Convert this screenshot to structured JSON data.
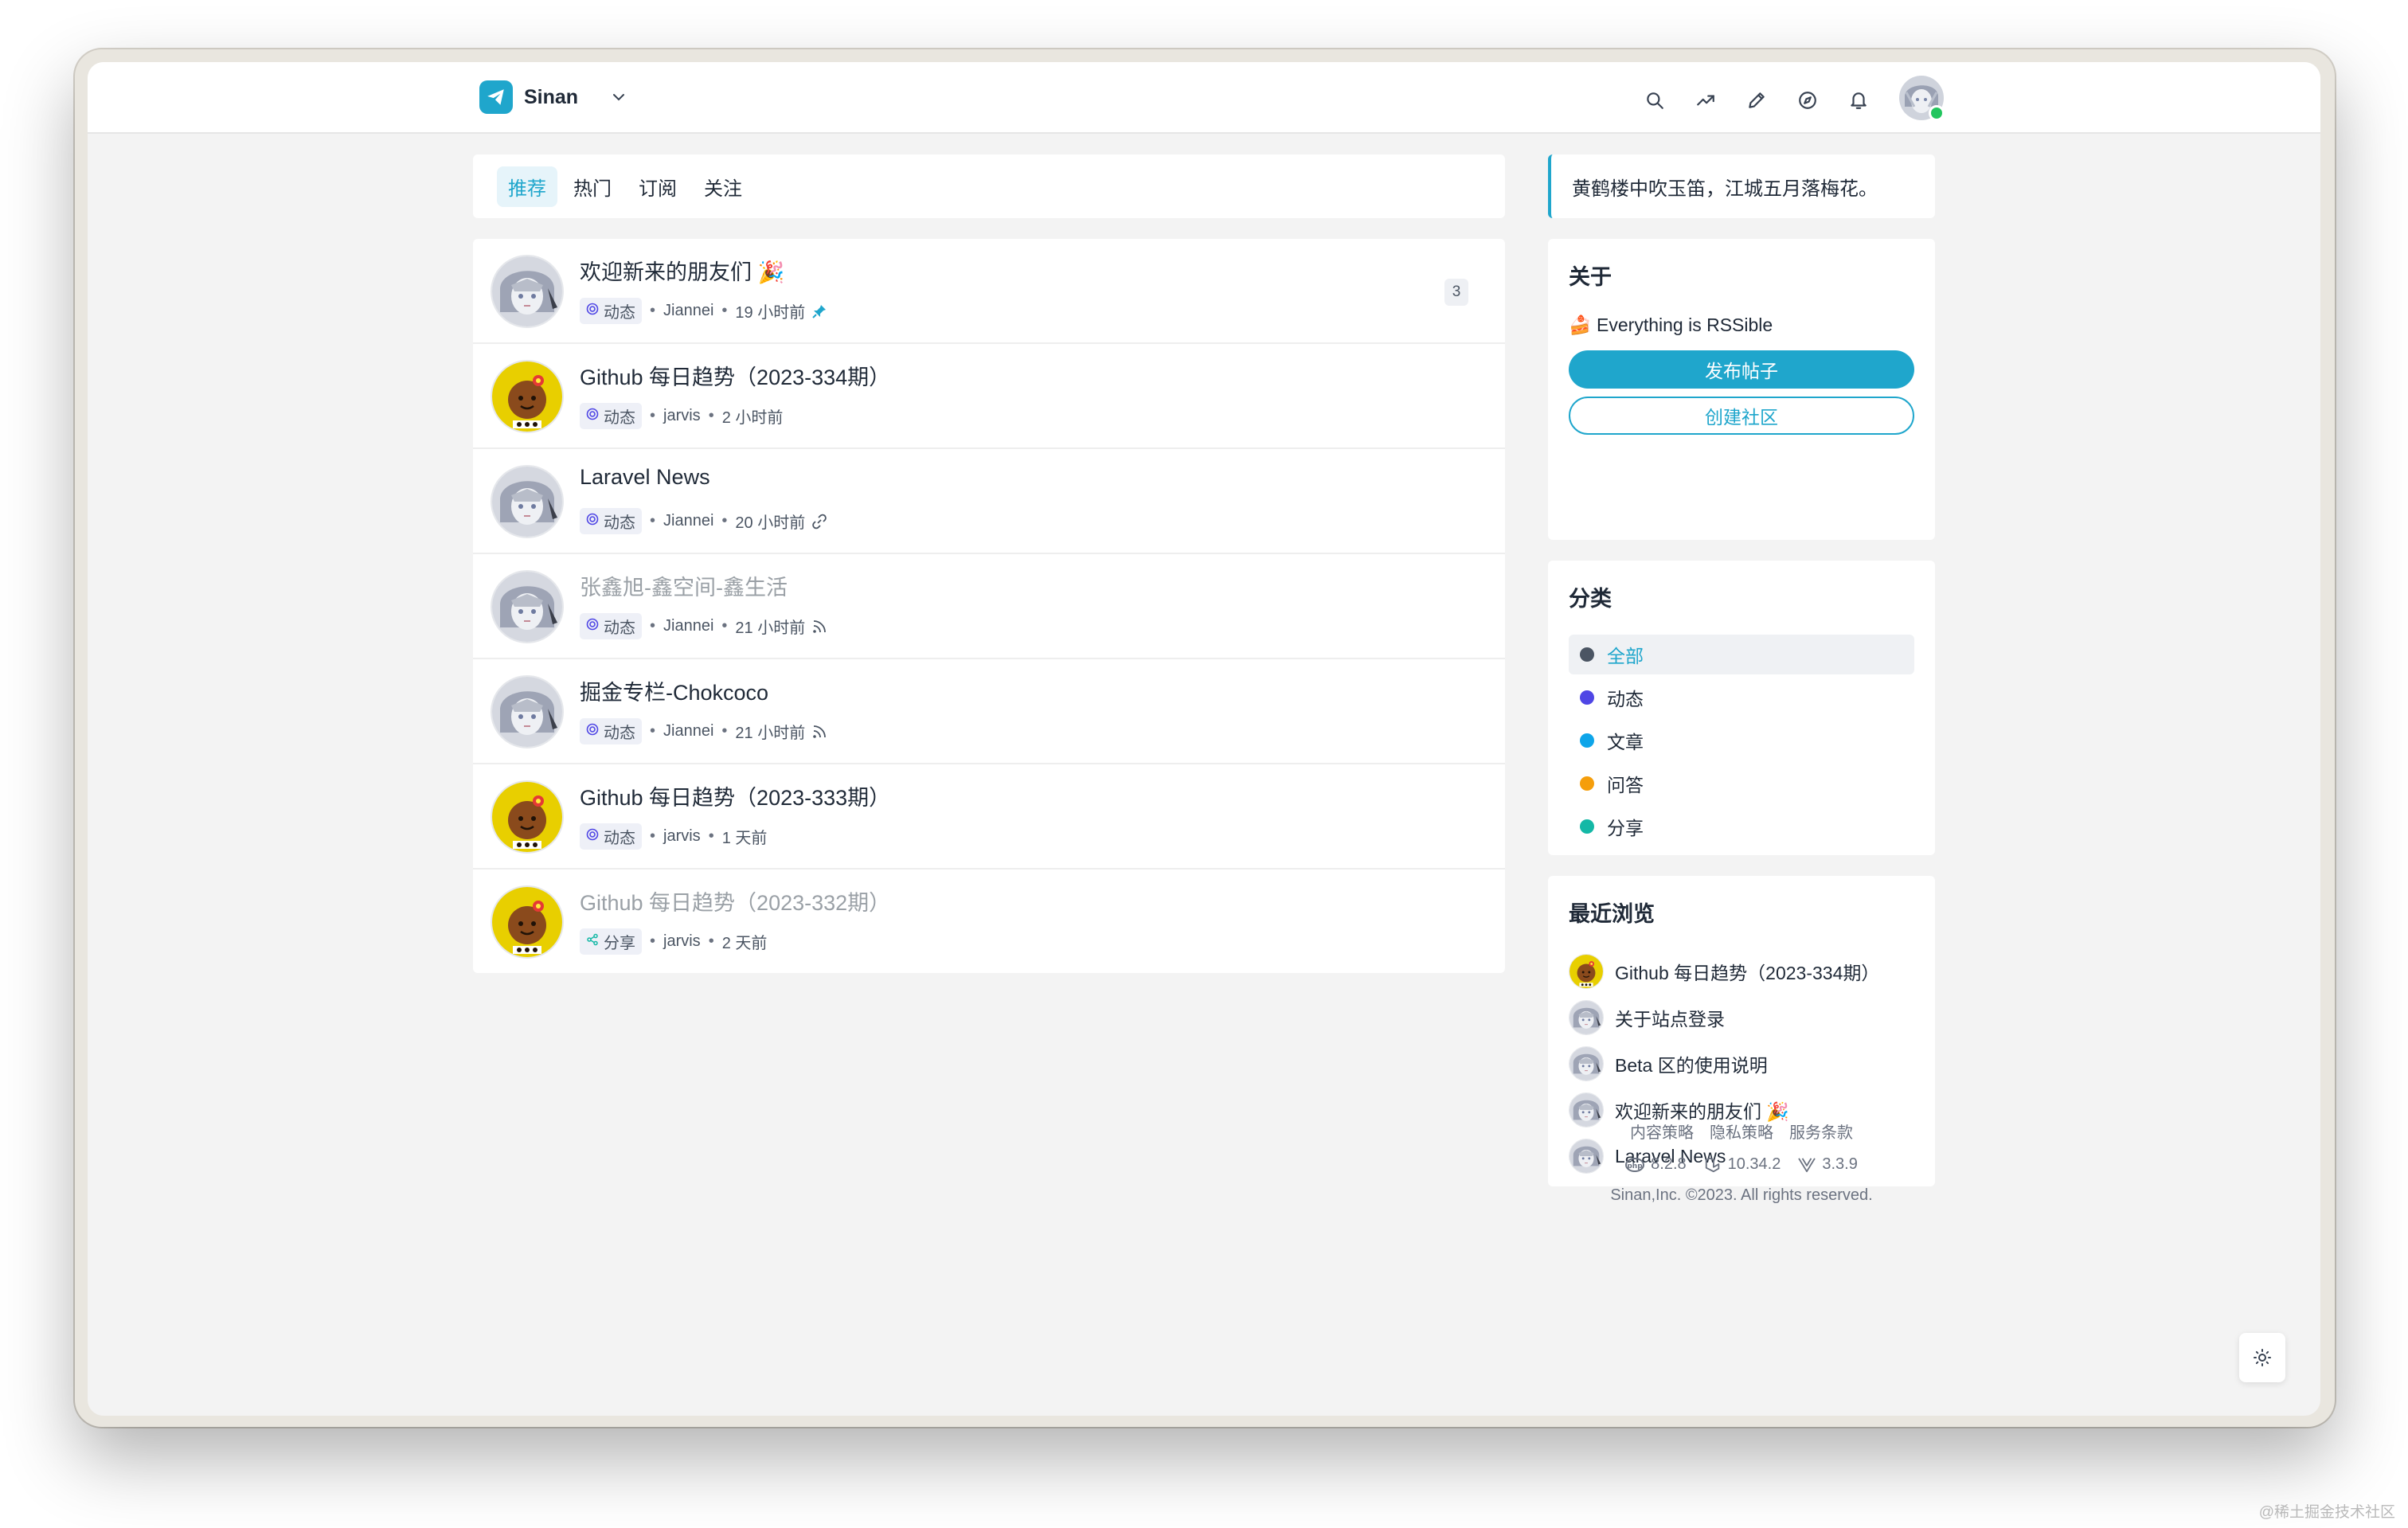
{
  "brand": {
    "name": "Sinan"
  },
  "top_icons": [
    "search-icon",
    "trending-icon",
    "compose-icon",
    "explore-icon",
    "bell-icon"
  ],
  "tabs": [
    {
      "label": "推荐",
      "active": true
    },
    {
      "label": "热门",
      "active": false
    },
    {
      "label": "订阅",
      "active": false
    },
    {
      "label": "关注",
      "active": false
    }
  ],
  "posts": [
    {
      "title": "欢迎新来的朋友们 🎉",
      "tag": "动态",
      "tag_icon": "feed-icon",
      "author": "Jiannei",
      "time": "19 小时前",
      "meta_icon": "pin-icon",
      "avatar": "anime",
      "badge": "3",
      "dim": false
    },
    {
      "title": "Github 每日趋势（2023-334期）",
      "tag": "动态",
      "tag_icon": "feed-icon",
      "author": "jarvis",
      "time": "2 小时前",
      "meta_icon": "",
      "avatar": "bot",
      "badge": "",
      "dim": false
    },
    {
      "title": "Laravel News",
      "tag": "动态",
      "tag_icon": "feed-icon",
      "author": "Jiannei",
      "time": "20 小时前",
      "meta_icon": "link-icon",
      "avatar": "anime",
      "badge": "",
      "dim": false
    },
    {
      "title": "张鑫旭-鑫空间-鑫生活",
      "tag": "动态",
      "tag_icon": "feed-icon",
      "author": "Jiannei",
      "time": "21 小时前",
      "meta_icon": "rss-icon",
      "avatar": "anime",
      "badge": "",
      "dim": true
    },
    {
      "title": "掘金专栏-Chokcoco",
      "tag": "动态",
      "tag_icon": "feed-icon",
      "author": "Jiannei",
      "time": "21 小时前",
      "meta_icon": "rss-icon",
      "avatar": "anime",
      "badge": "",
      "dim": false
    },
    {
      "title": "Github 每日趋势（2023-333期）",
      "tag": "动态",
      "tag_icon": "feed-icon",
      "author": "jarvis",
      "time": "1 天前",
      "meta_icon": "",
      "avatar": "bot",
      "badge": "",
      "dim": false
    },
    {
      "title": "Github 每日趋势（2023-332期）",
      "tag": "分享",
      "tag_icon": "share-icon",
      "author": "jarvis",
      "time": "2 天前",
      "meta_icon": "",
      "avatar": "bot",
      "badge": "",
      "dim": true
    }
  ],
  "quote": "黄鹤楼中吹玉笛，江城五月落梅花。",
  "about": {
    "title": "关于",
    "tagline": "🍰 Everything is RSSible",
    "primary_button": "发布帖子",
    "secondary_button": "创建社区"
  },
  "categories": {
    "title": "分类",
    "items": [
      {
        "label": "全部",
        "color": "#4b5563",
        "active": true
      },
      {
        "label": "动态",
        "color": "#4f46e5",
        "active": false
      },
      {
        "label": "文章",
        "color": "#0ea5e9",
        "active": false
      },
      {
        "label": "问答",
        "color": "#f59e0b",
        "active": false
      },
      {
        "label": "分享",
        "color": "#14b8a6",
        "active": false
      }
    ]
  },
  "recent": {
    "title": "最近浏览",
    "items": [
      {
        "label": "Github 每日趋势（2023-334期）",
        "avatar": "bot"
      },
      {
        "label": "关于站点登录",
        "avatar": "anime"
      },
      {
        "label": "Beta 区的使用说明",
        "avatar": "anime"
      },
      {
        "label": "欢迎新来的朋友们 🎉",
        "avatar": "anime"
      },
      {
        "label": "Laravel News",
        "avatar": "anime"
      }
    ]
  },
  "footer": {
    "links": [
      "内容策略",
      "隐私策略",
      "服务条款"
    ],
    "versions": [
      {
        "icon": "php-icon",
        "value": "8.2.8"
      },
      {
        "icon": "laravel-icon",
        "value": "10.34.2"
      },
      {
        "icon": "vue-icon",
        "value": "3.3.9"
      }
    ],
    "copyright": "Sinan,Inc. ©2023. All rights reserved."
  },
  "watermark": "@稀土掘金技术社区",
  "colors": {
    "accent": "#1fa6cc",
    "background": "#f3f3f3",
    "online": "#22c55e"
  }
}
